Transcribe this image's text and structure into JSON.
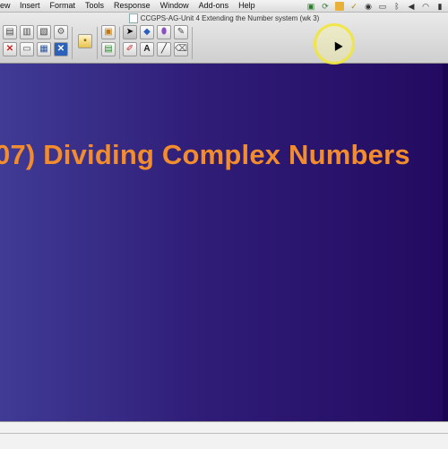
{
  "menubar": {
    "items": [
      "ew",
      "Insert",
      "Format",
      "Tools",
      "Response",
      "Window",
      "Add-ons",
      "Help"
    ],
    "tray_icons": [
      "smartboard-icon",
      "network-icon",
      "notes-icon",
      "check-icon",
      "cd-icon",
      "display-icon",
      "bluetooth-icon",
      "volume-icon",
      "wifi-icon",
      "battery-icon"
    ]
  },
  "window": {
    "title": "CCGPS-AG-Unit 4 Extending the Number system (wk 3)"
  },
  "toolbar": {
    "group1": [
      "new-page-icon",
      "insert-page-icon",
      "open-icon",
      "gear-icon",
      "delete-icon",
      "screen-icon",
      "table-icon",
      "close-icon"
    ],
    "group2": [
      "lock-icon"
    ],
    "group3": [
      "screen-capture-icon",
      "add-page-icon"
    ],
    "group4": [
      "select-arrow-icon",
      "shape-fill-icon",
      "eraser-pen-icon",
      "magic-pen-icon",
      "pens-icon",
      "text-icon",
      "line-icon",
      "eraser-icon"
    ]
  },
  "slide": {
    "title": "07) Dividing Complex Numbers",
    "colors": {
      "title": "#f28c2c",
      "bg_left": "#403b95",
      "bg_right": "#230a60"
    }
  }
}
